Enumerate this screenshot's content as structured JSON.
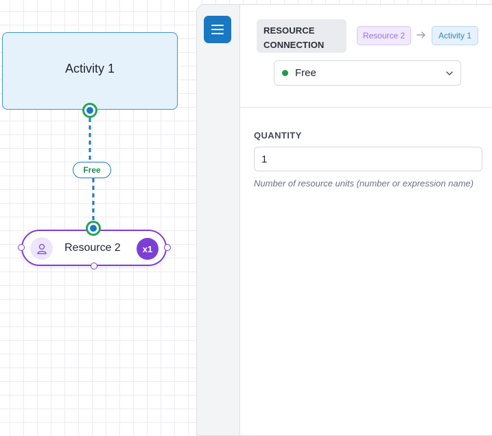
{
  "canvas": {
    "activity_node": {
      "label": "Activity 1"
    },
    "edge": {
      "label": "Free"
    },
    "resource_node": {
      "label": "Resource 2",
      "multiplier": "x1"
    }
  },
  "panel": {
    "type_chip_line1": "RESOURCE",
    "type_chip_line2": "CONNECTION",
    "from_label": "Resource 2",
    "to_label": "Activity 1",
    "status_select": {
      "value": "Free",
      "dot_color": "#1f9a4d"
    },
    "quantity_field": {
      "label": "QUANTITY",
      "value": "1",
      "help": "Number of resource units (number or expression name)"
    }
  },
  "icons": {
    "menu": "hamburger-menu-icon",
    "arrow": "arrow-right-icon",
    "chevron": "chevron-down-icon",
    "avatar": "user-icon"
  },
  "colors": {
    "accent": "#1a78c2",
    "resource_purple": "#7c3fd6",
    "port_green": "#22a553",
    "activity_fill": "#e5f2fb"
  }
}
